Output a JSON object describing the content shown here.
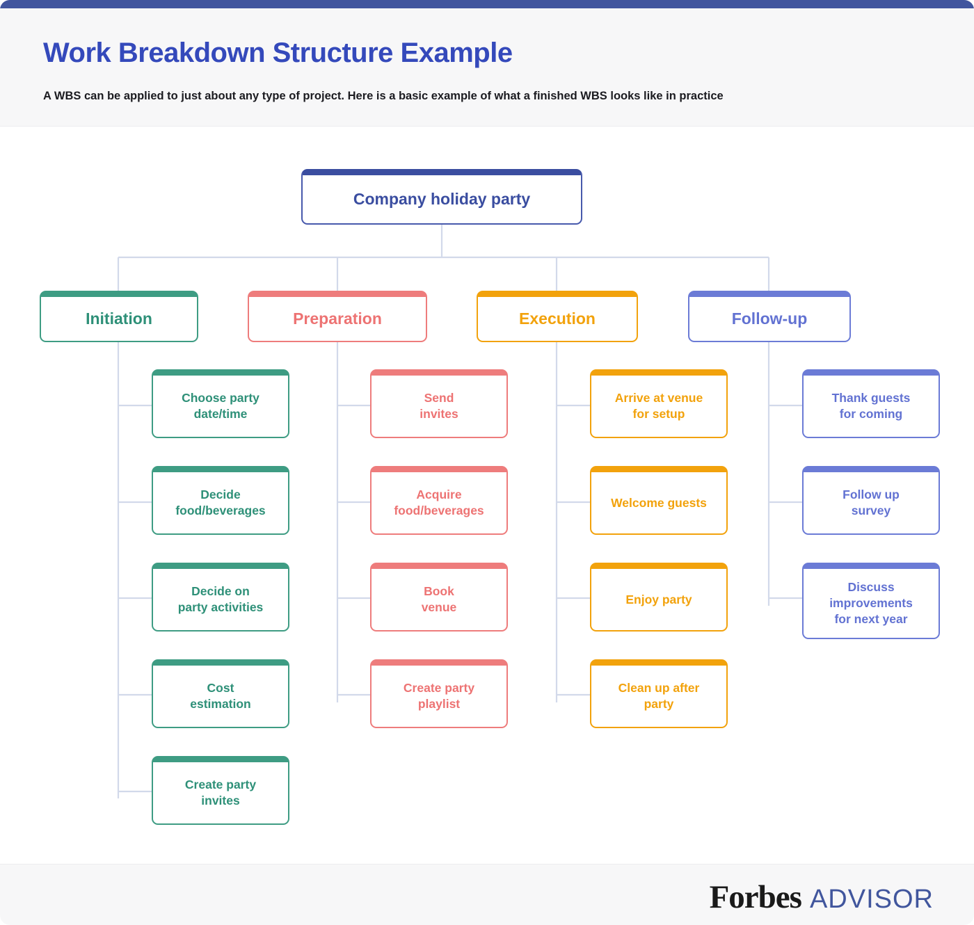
{
  "header": {
    "title": "Work Breakdown Structure Example",
    "subtitle": "A WBS can be applied to just about any type of project. Here is a basic example of what a finished WBS looks like in practice"
  },
  "colors": {
    "header_bar": "#42569E",
    "title_blue": "#3449BB",
    "root_blue": "#3A4DA0",
    "green": "#3E9C83",
    "coral": "#EE7C7C",
    "orange": "#F2A20C",
    "periwinkle": "#6B7BD6",
    "connector": "#D2D9EA",
    "panel_gray": "#F7F7F8"
  },
  "chart_data": {
    "type": "diagram",
    "title": "Work Breakdown Structure Example",
    "root": "Company holiday party",
    "branches": [
      {
        "name": "Initiation",
        "color": "#3E9C83",
        "tasks": [
          "Choose party\ndate/time",
          "Decide\nfood/beverages",
          "Decide on\nparty activities",
          "Cost\nestimation",
          "Create party\ninvites"
        ]
      },
      {
        "name": "Preparation",
        "color": "#EE7C7C",
        "tasks": [
          "Send\ninvites",
          "Acquire\nfood/beverages",
          "Book\nvenue",
          "Create party\nplaylist"
        ]
      },
      {
        "name": "Execution",
        "color": "#F2A20C",
        "tasks": [
          "Arrive at venue\nfor setup",
          "Welcome guests",
          "Enjoy party",
          "Clean up after\nparty"
        ]
      },
      {
        "name": "Follow-up",
        "color": "#6B7BD6",
        "tasks": [
          "Thank guests\nfor coming",
          "Follow up\nsurvey",
          "Discuss\nimprovements\nfor next year"
        ]
      }
    ]
  },
  "diagram": {
    "root": {
      "label": "Company holiday party"
    },
    "phases": [
      {
        "label": "Initiation"
      },
      {
        "label": "Preparation"
      },
      {
        "label": "Execution"
      },
      {
        "label": "Follow-up"
      }
    ],
    "initiation_tasks": [
      {
        "line1": "Choose party",
        "line2": "date/time"
      },
      {
        "line1": "Decide",
        "line2": "food/beverages"
      },
      {
        "line1": "Decide on",
        "line2": "party activities"
      },
      {
        "line1": "Cost",
        "line2": "estimation"
      },
      {
        "line1": "Create party",
        "line2": "invites"
      }
    ],
    "preparation_tasks": [
      {
        "line1": "Send",
        "line2": "invites"
      },
      {
        "line1": "Acquire",
        "line2": "food/beverages"
      },
      {
        "line1": "Book",
        "line2": "venue"
      },
      {
        "line1": "Create party",
        "line2": "playlist"
      }
    ],
    "execution_tasks": [
      {
        "line1": "Arrive at venue",
        "line2": "for setup"
      },
      {
        "line1": "Welcome guests",
        "line2": ""
      },
      {
        "line1": "Enjoy party",
        "line2": ""
      },
      {
        "line1": "Clean up after",
        "line2": "party"
      }
    ],
    "followup_tasks": [
      {
        "line1": "Thank guests",
        "line2": "for coming",
        "line3": ""
      },
      {
        "line1": "Follow up",
        "line2": "survey",
        "line3": ""
      },
      {
        "line1": "Discuss",
        "line2": "improvements",
        "line3": "for next year"
      }
    ]
  },
  "footer": {
    "logo_primary": "Forbes",
    "logo_secondary": "ADVISOR"
  }
}
